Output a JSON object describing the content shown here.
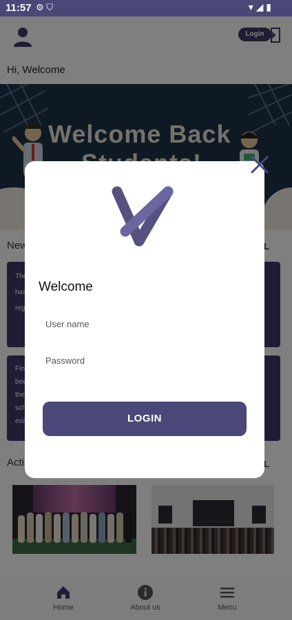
{
  "status_bar": {
    "time": "11:57"
  },
  "header": {
    "login_label": "Login"
  },
  "greeting": "Hi, Welcome",
  "banner": {
    "title": "Welcome Back",
    "subtitle": "Students!"
  },
  "news": {
    "title": "New",
    "see_all": "L",
    "cards": [
      {
        "lines": [
          "The",
          "has",
          "reg"
        ]
      },
      {
        "lines": [
          "Fin",
          "bee",
          "the",
          "sch",
          "exa"
        ]
      }
    ]
  },
  "activities": {
    "title": "Acti",
    "see_all": "L"
  },
  "bottom_nav": {
    "items": [
      {
        "label": "Home"
      },
      {
        "label": "About us"
      },
      {
        "label": "Menu"
      }
    ]
  },
  "dialog": {
    "welcome": "Welcome",
    "username_placeholder": "User name",
    "password_placeholder": "Password",
    "login_button": "LOGIN"
  },
  "colors": {
    "primary": "#4a4878",
    "statusbar": "#4a4876",
    "banner": "#1d3349"
  }
}
